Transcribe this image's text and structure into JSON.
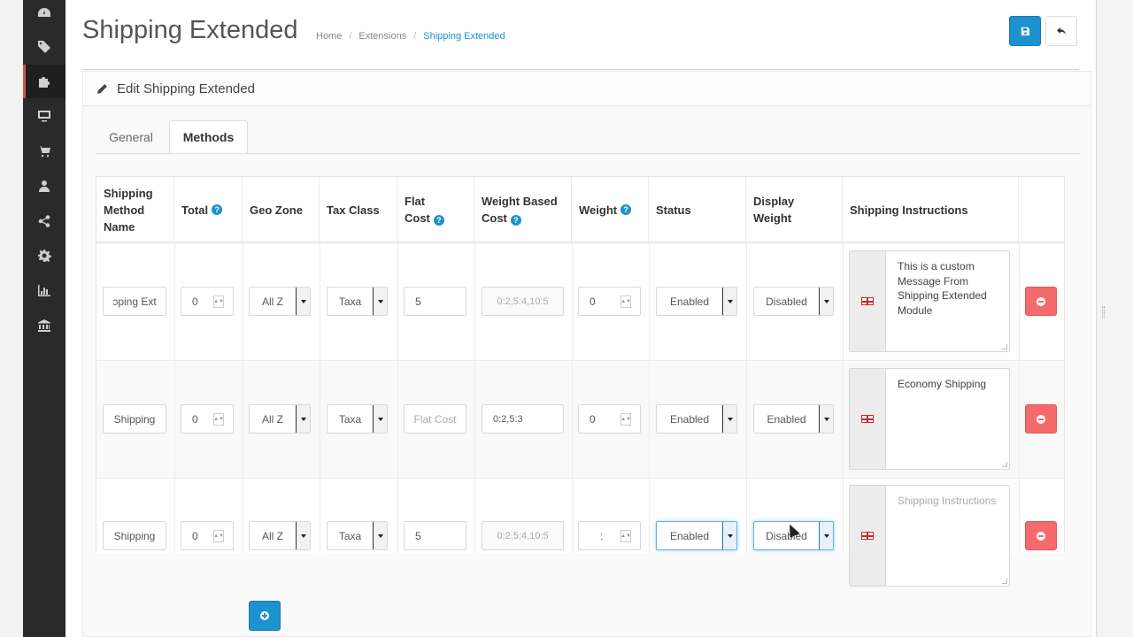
{
  "header": {
    "title": "Shipping Extended",
    "breadcrumb": [
      "Home",
      "Extensions",
      "Shipping Extended"
    ],
    "save_icon": "save-icon",
    "back_icon": "reply-icon"
  },
  "sidebar": {
    "items": [
      {
        "icon": "dashboard-icon"
      },
      {
        "icon": "tags-icon"
      },
      {
        "icon": "puzzle-icon",
        "active": true
      },
      {
        "icon": "monitor-icon"
      },
      {
        "icon": "cart-icon"
      },
      {
        "icon": "user-icon"
      },
      {
        "icon": "share-icon"
      },
      {
        "icon": "gear-icon"
      },
      {
        "icon": "bar-chart-icon"
      },
      {
        "icon": "bank-icon"
      }
    ]
  },
  "panel": {
    "heading": "Edit Shipping Extended",
    "tabs": [
      "General",
      "Methods"
    ],
    "active_tab": "Methods"
  },
  "table": {
    "headers": {
      "name": "Shipping Method Name",
      "total": "Total",
      "geo_zone": "Geo Zone",
      "tax_class": "Tax Class",
      "flat_cost": "Flat Cost",
      "weight_based_cost": "Weight Based Cost",
      "weight": "Weight",
      "status": "Status",
      "display_weight": "Display Weight",
      "instructions": "Shipping Instructions"
    },
    "help_mark": "?",
    "rows": [
      {
        "name": "ɔping Ext",
        "total": "0",
        "geo_zone": "All Z",
        "tax_class": "Taxa",
        "flat_cost": "5",
        "weight_based_cost": "0:2,5:4,10:5",
        "weight": "0",
        "status": "Enabled",
        "display_weight": "Disabled",
        "instructions": "This is a custom Message From Shipping Extended Module"
      },
      {
        "name": "Shipping",
        "total": "0",
        "geo_zone": "All Z",
        "tax_class": "Taxa",
        "flat_cost_placeholder": "Flat Cost",
        "weight_based_cost": "0:2,5:3",
        "weight": "0",
        "status": "Enabled",
        "display_weight": "Enabled",
        "instructions": "Economy Shipping"
      },
      {
        "name": "Shipping",
        "total": "0",
        "geo_zone": "All Z",
        "tax_class": "Taxa",
        "flat_cost": "5",
        "weight_based_cost": "0:2,5:4,10:5",
        "weight": ":",
        "status": "Enabled",
        "display_weight": "Disabled",
        "instructions_placeholder": "Shipping Instructions"
      }
    ]
  },
  "colors": {
    "primary": "#1e91cf",
    "danger": "#f56b6b",
    "sidebar": "#2a2a2a"
  }
}
